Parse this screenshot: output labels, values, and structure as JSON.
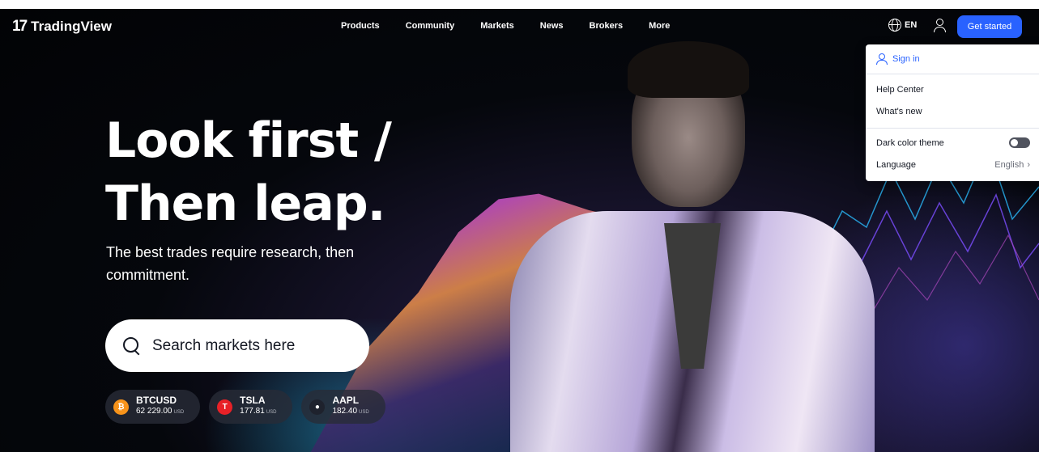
{
  "brand": {
    "logo_mark": "17",
    "name": "TradingView"
  },
  "nav": {
    "items": [
      "Products",
      "Community",
      "Markets",
      "News",
      "Brokers",
      "More"
    ]
  },
  "header": {
    "language_label": "EN",
    "cta_label": "Get started",
    "accent_color": "#2962ff"
  },
  "user_menu": {
    "sign_in": "Sign in",
    "help_center": "Help Center",
    "whats_new": "What's new",
    "dark_theme_label": "Dark color theme",
    "dark_theme_on": false,
    "language_label": "Language",
    "language_value": "English"
  },
  "hero": {
    "headline_line1": "Look first /",
    "headline_line2": "Then leap.",
    "subhead": "The best trades require research, then commitment."
  },
  "search": {
    "placeholder": "Search markets here"
  },
  "tickers": [
    {
      "symbol": "BTCUSD",
      "price": "62 229.00",
      "currency": "USD",
      "icon": "bitcoin-icon",
      "color": "#f7931a",
      "glyph": "₿"
    },
    {
      "symbol": "TSLA",
      "price": "177.81",
      "currency": "USD",
      "icon": "tesla-icon",
      "color": "#e82127",
      "glyph": "T"
    },
    {
      "symbol": "AAPL",
      "price": "182.40",
      "currency": "USD",
      "icon": "apple-icon",
      "color": "#1e222d",
      "glyph": "●"
    }
  ]
}
